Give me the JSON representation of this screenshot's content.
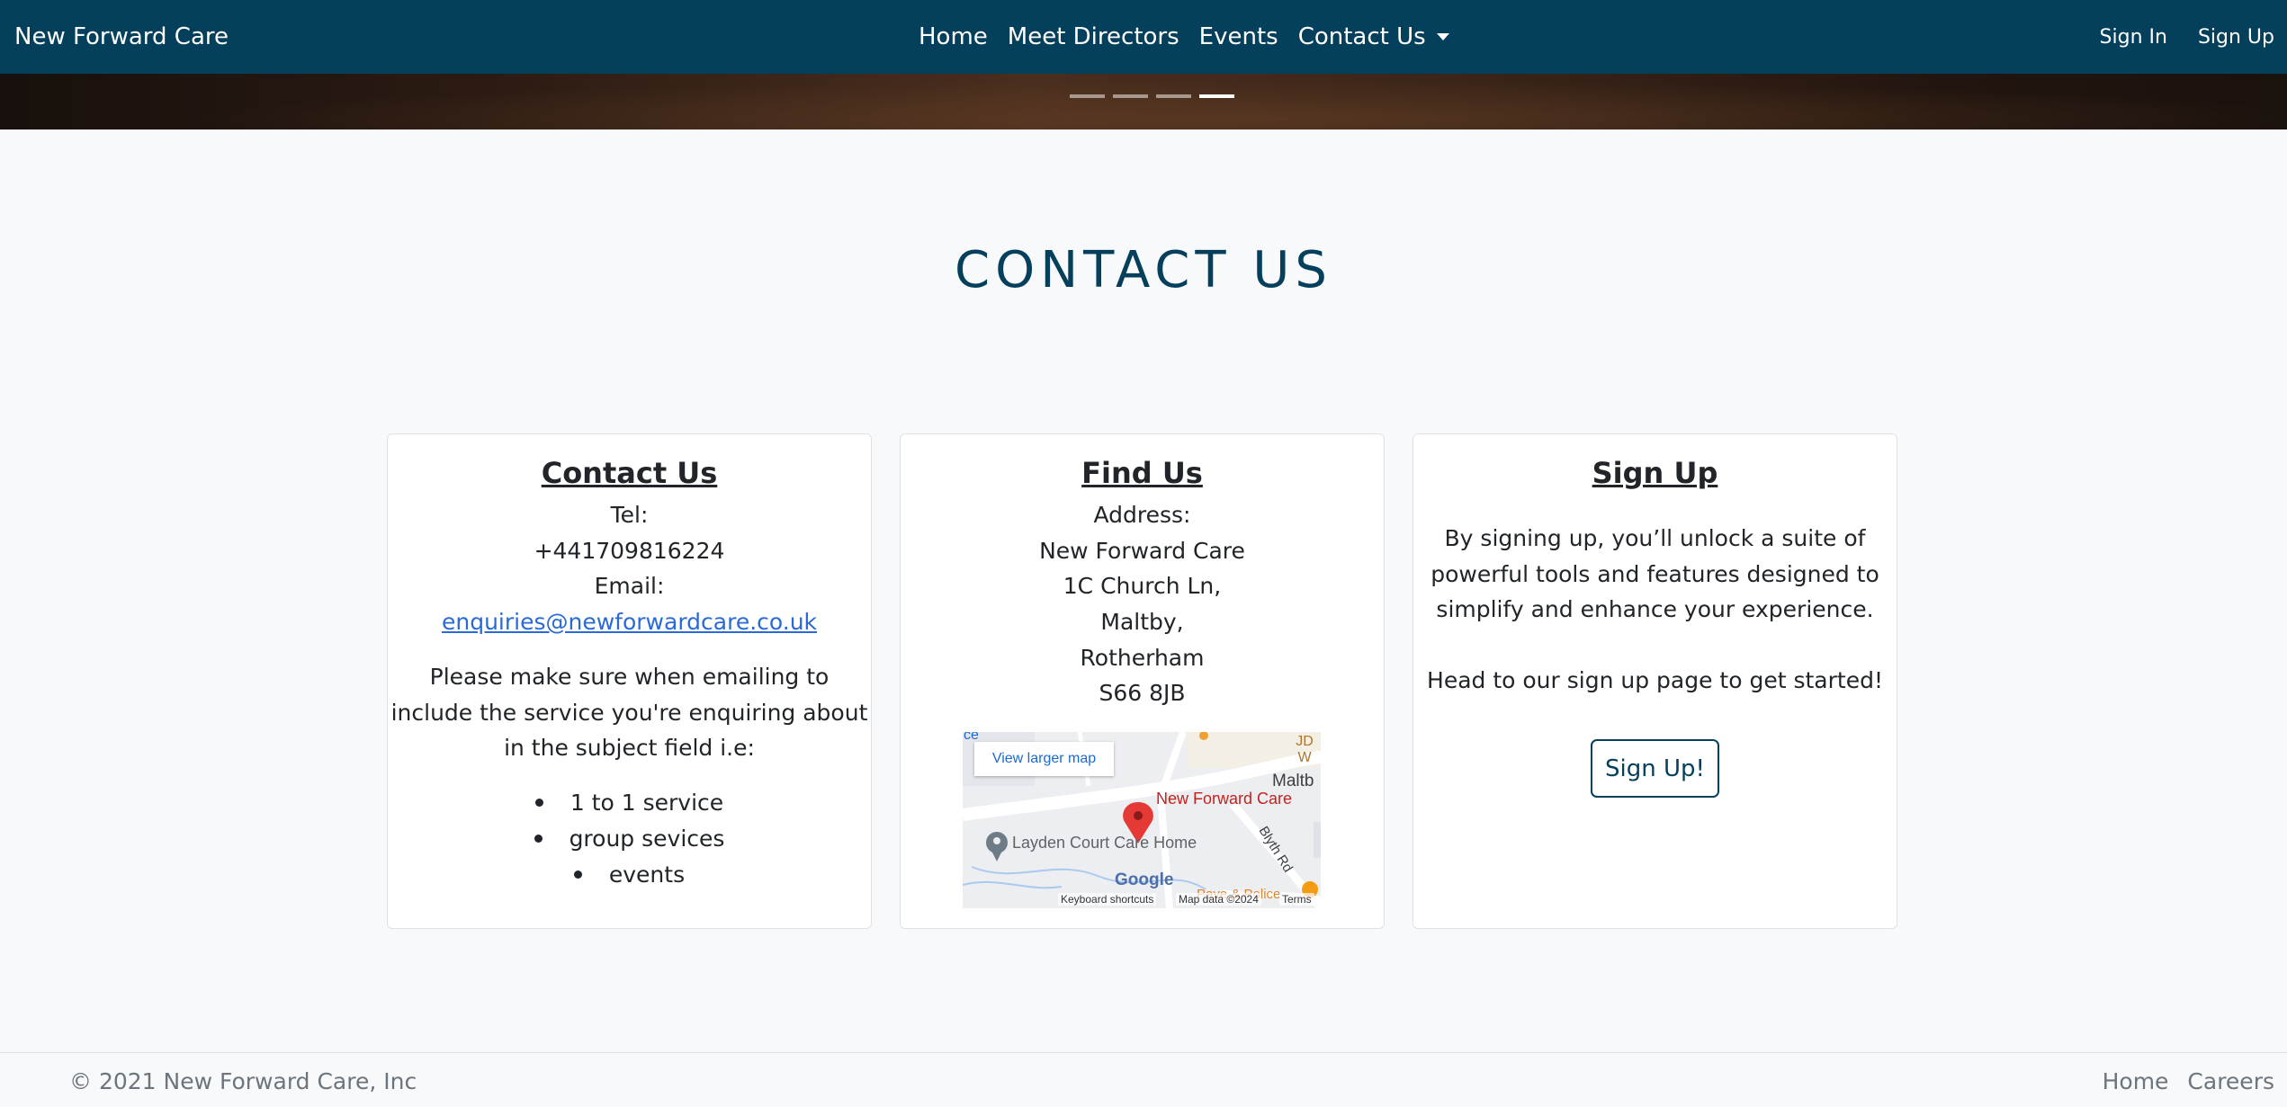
{
  "navbar": {
    "brand": "New Forward Care",
    "links": [
      "Home",
      "Meet Directors",
      "Events",
      "Contact Us"
    ],
    "sign_in": "Sign In",
    "sign_up": "Sign Up"
  },
  "carousel": {
    "slides": 4,
    "active_index": 3
  },
  "page": {
    "title": "CONTACT US"
  },
  "contact_card": {
    "title": "Contact Us",
    "tel_label": "Tel:",
    "tel": "+441709816224",
    "email_label": "Email:",
    "email": "enquiries@newforwardcare.co.uk",
    "note_lines": [
      "Please make sure when emailing to",
      "include the service you're enquiring about",
      "in the subject field i.e:"
    ],
    "services": [
      "1 to 1 service",
      "group sevices",
      "events"
    ]
  },
  "find_card": {
    "title": "Find Us",
    "address_label": "Address:",
    "address_lines": [
      "New Forward Care",
      "1C Church Ln,",
      "Maltby,",
      "Rotherham",
      "S66 8JB"
    ],
    "map": {
      "larger_map": "View larger map",
      "pin_label": "New Forward Care",
      "poi_label": "Layden Court Care Home",
      "town_label": "Maltb",
      "road_label": "Blyth Rd",
      "jd_label": "JD W",
      "partial_left": "ce",
      "bottom_poi": "Pave & Police",
      "google": "Google",
      "keyboard": "Keyboard shortcuts",
      "map_data": "Map data ©2024",
      "terms": "Terms"
    }
  },
  "signup_card": {
    "title": "Sign Up",
    "para1": [
      "By signing up, you’ll unlock a suite of",
      "powerful tools and features designed to",
      "simplify and enhance your experience."
    ],
    "para2": "Head to our sign up page to get started!",
    "button": "Sign Up!"
  },
  "footer": {
    "copyright": "© 2021 New Forward Care, Inc",
    "links": [
      "Home",
      "Careers"
    ]
  },
  "colors": {
    "navbar": "#043f5c",
    "heading": "#043f5c",
    "link": "#2a6ad6",
    "background": "#f8f9fa"
  }
}
